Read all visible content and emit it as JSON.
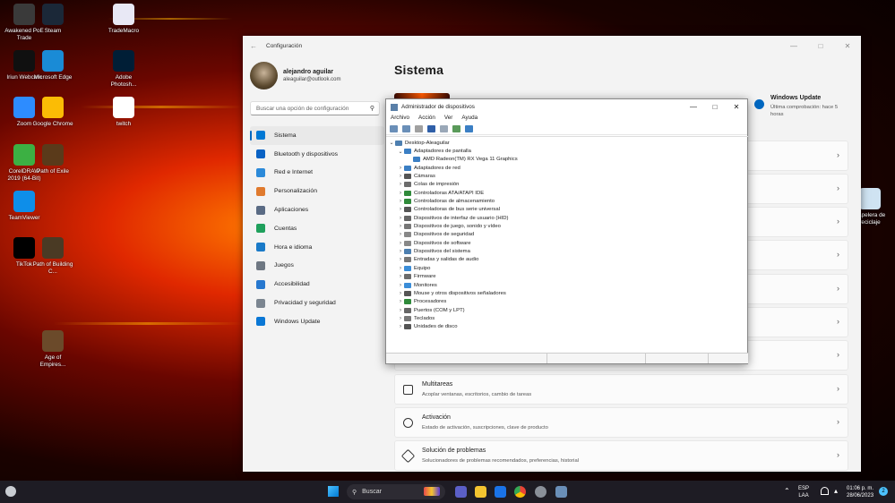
{
  "desktop": {
    "icons": [
      {
        "label": "Awakened PoE Trade",
        "color": "#3a3a3a"
      },
      {
        "label": "Steam",
        "color": "#1b2838"
      },
      {
        "label": "TradeMacro",
        "color": "#e8e8f5"
      },
      {
        "label": "Iriun Webcam",
        "color": "#101010"
      },
      {
        "label": "Microsoft Edge",
        "color": "#1a8bd6"
      },
      {
        "label": "Adobe Photosh...",
        "color": "#001e36"
      },
      {
        "label": "Zoom",
        "color": "#2d8cff"
      },
      {
        "label": "Google Chrome",
        "color": "#fbbc05"
      },
      {
        "label": "twitch",
        "color": "#ffffff"
      },
      {
        "label": "CorelDRAW 2019 (64-Bit)",
        "color": "#3cb043"
      },
      {
        "label": "Path of Exile",
        "color": "#5a3a1a"
      },
      {
        "label": "TeamViewer",
        "color": "#0e8ee9"
      },
      {
        "label": "TikTok",
        "color": "#000000"
      },
      {
        "label": "Path of Building C...",
        "color": "#4a3a24"
      },
      {
        "label": "Age of Empires...",
        "color": "#6b4a2a"
      },
      {
        "label": "Papelera de reciclaje",
        "color": "#cfe3f2"
      }
    ]
  },
  "settings": {
    "window_title": "Configuración",
    "user_name": "alejandro aguilar",
    "user_email": "aleaguilar@outlook.com",
    "search_placeholder": "Buscar una opción de configuración",
    "page_title": "Sistema",
    "nav": [
      {
        "label": "Sistema",
        "icon": "monitor-icon",
        "color": "#0078d4"
      },
      {
        "label": "Bluetooth y dispositivos",
        "icon": "bluetooth-icon",
        "color": "#0a62c4"
      },
      {
        "label": "Red e Internet",
        "icon": "wifi-icon",
        "color": "#2c8ad9"
      },
      {
        "label": "Personalización",
        "icon": "brush-icon",
        "color": "#e07a2e"
      },
      {
        "label": "Aplicaciones",
        "icon": "apps-icon",
        "color": "#5a6b84"
      },
      {
        "label": "Cuentas",
        "icon": "person-icon",
        "color": "#1fa05c"
      },
      {
        "label": "Hora e idioma",
        "icon": "globe-icon",
        "color": "#1a7ac8"
      },
      {
        "label": "Juegos",
        "icon": "gamepad-icon",
        "color": "#6e7782"
      },
      {
        "label": "Accesibilidad",
        "icon": "accessibility-icon",
        "color": "#2778cf"
      },
      {
        "label": "Privacidad y seguridad",
        "icon": "shield-icon",
        "color": "#7b8590"
      },
      {
        "label": "Windows Update",
        "icon": "update-icon",
        "color": "#0a77d5"
      }
    ],
    "windows_update": {
      "title": "Windows Update",
      "subtitle_line1": "Última comprobación: hace 5",
      "subtitle_line2": "horas"
    },
    "cards": [
      {
        "title": "Multitareas",
        "subtitle": "Acoplar ventanas, escritorios, cambio de tareas",
        "icon": "multitask-icon"
      },
      {
        "title": "Activación",
        "subtitle": "Estado de activación, suscripciones, clave de producto",
        "icon": "check-circle-icon"
      },
      {
        "title": "Solución de problemas",
        "subtitle": "Solucionadores de problemas recomendados, preferencias, historial",
        "icon": "wrench-icon"
      }
    ]
  },
  "device_manager": {
    "title": "Administrador de dispositivos",
    "menu": [
      "Archivo",
      "Acción",
      "Ver",
      "Ayuda"
    ],
    "root": "Desktop-Aleaguilar",
    "display_adapters": "Adaptadores de pantalla",
    "gpu": "AMD Radeon(TM) RX Vega 11 Graphics",
    "categories": [
      {
        "label": "Adaptadores de red",
        "color": "#3b7fc4"
      },
      {
        "label": "Cámaras",
        "color": "#555555"
      },
      {
        "label": "Colas de impresión",
        "color": "#6c6c6c"
      },
      {
        "label": "Controladoras ATA/ATAPI IDE",
        "color": "#2f8a3a"
      },
      {
        "label": "Controladoras de almacenamiento",
        "color": "#2f8a3a"
      },
      {
        "label": "Controladoras de bus serie universal",
        "color": "#555555"
      },
      {
        "label": "Dispositivos de interfaz de usuario (HID)",
        "color": "#666666"
      },
      {
        "label": "Dispositivos de juego, sonido y vídeo",
        "color": "#777777"
      },
      {
        "label": "Dispositivos de seguridad",
        "color": "#888888"
      },
      {
        "label": "Dispositivos de software",
        "color": "#888888"
      },
      {
        "label": "Dispositivos del sistema",
        "color": "#4d7fb0"
      },
      {
        "label": "Entradas y salidas de audio",
        "color": "#777777"
      },
      {
        "label": "Equipo",
        "color": "#3b8dd8"
      },
      {
        "label": "Firmware",
        "color": "#6c6c6c"
      },
      {
        "label": "Monitores",
        "color": "#3b8dd8"
      },
      {
        "label": "Mouse y otros dispositivos señaladores",
        "color": "#555555"
      },
      {
        "label": "Procesadores",
        "color": "#2f8a3a"
      },
      {
        "label": "Puertos (COM y LPT)",
        "color": "#666666"
      },
      {
        "label": "Teclados",
        "color": "#777777"
      },
      {
        "label": "Unidades de disco",
        "color": "#555555"
      }
    ]
  },
  "taskbar": {
    "search_label": "Buscar",
    "language": "ESP",
    "layout": "LAA",
    "time": "01:06 p. m.",
    "date": "28/06/2023",
    "notifications": "2"
  }
}
